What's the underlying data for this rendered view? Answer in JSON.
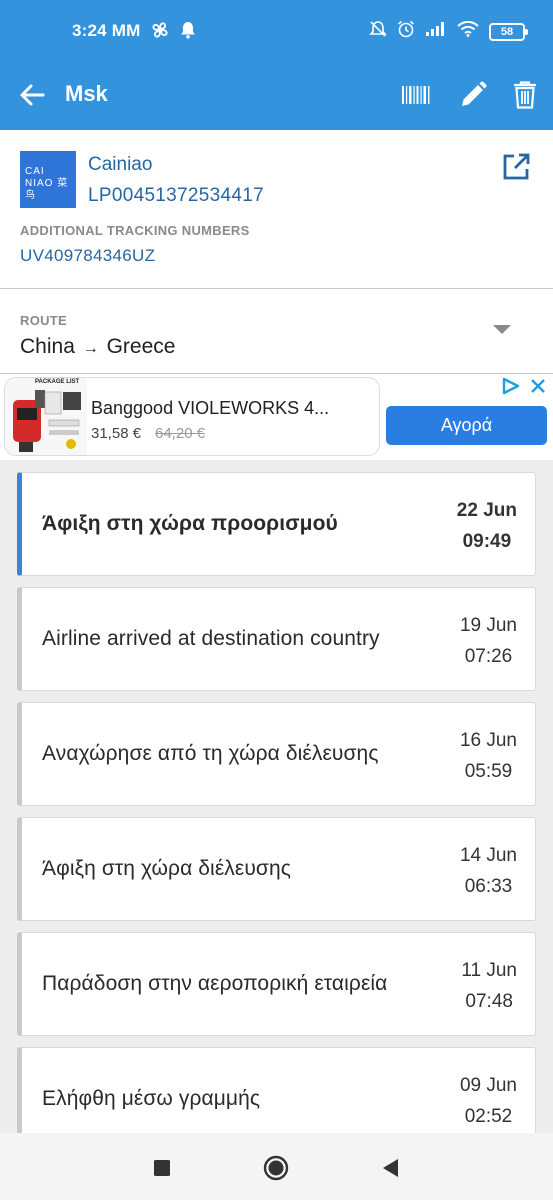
{
  "status_bar": {
    "time": "3:24 MM",
    "battery": "58"
  },
  "app_bar": {
    "title": "Msk",
    "icons": [
      "back-arrow-icon",
      "barcode-icon",
      "edit-pencil-icon",
      "delete-trash-icon"
    ]
  },
  "carrier": {
    "logo_text_line1": "CAI",
    "logo_text_line2": "NIAO 菜鸟",
    "name": "Cainiao",
    "tracking_number": "LP00451372534417",
    "additional_label": "ADDITIONAL TRACKING NUMBERS",
    "additional_number": "UV409784346UZ"
  },
  "route": {
    "label": "ROUTE",
    "from": "China",
    "arrow": "→",
    "to": "Greece"
  },
  "ad": {
    "image_caption": "PACKAGE LIST",
    "title": "Banggood VIOLEWORKS 4...",
    "price": "31,58 €",
    "old_price": "64,20 €",
    "cta": "Αγορά"
  },
  "events": [
    {
      "text": "Άφιξη στη χώρα προορισμού",
      "date": "22 Jun",
      "time": "09:49",
      "active": true
    },
    {
      "text": "Airline arrived at destination country",
      "date": "19 Jun",
      "time": "07:26",
      "active": false
    },
    {
      "text": "Αναχώρησε από τη χώρα διέλευσης",
      "date": "16 Jun",
      "time": "05:59",
      "active": false
    },
    {
      "text": "Άφιξη στη χώρα διέλευσης",
      "date": "14 Jun",
      "time": "06:33",
      "active": false
    },
    {
      "text": "Παράδοση στην αεροπορική εταιρεία",
      "date": "11 Jun",
      "time": "07:48",
      "active": false
    },
    {
      "text": "Ελήφθη μέσω γραμμής",
      "date": "09 Jun",
      "time": "02:52",
      "active": false
    }
  ],
  "colors": {
    "app_bar": "#3393dc",
    "link_blue": "#2666a3",
    "active_event_accent": "#3a86d4",
    "cta_blue": "#2a7de1"
  }
}
